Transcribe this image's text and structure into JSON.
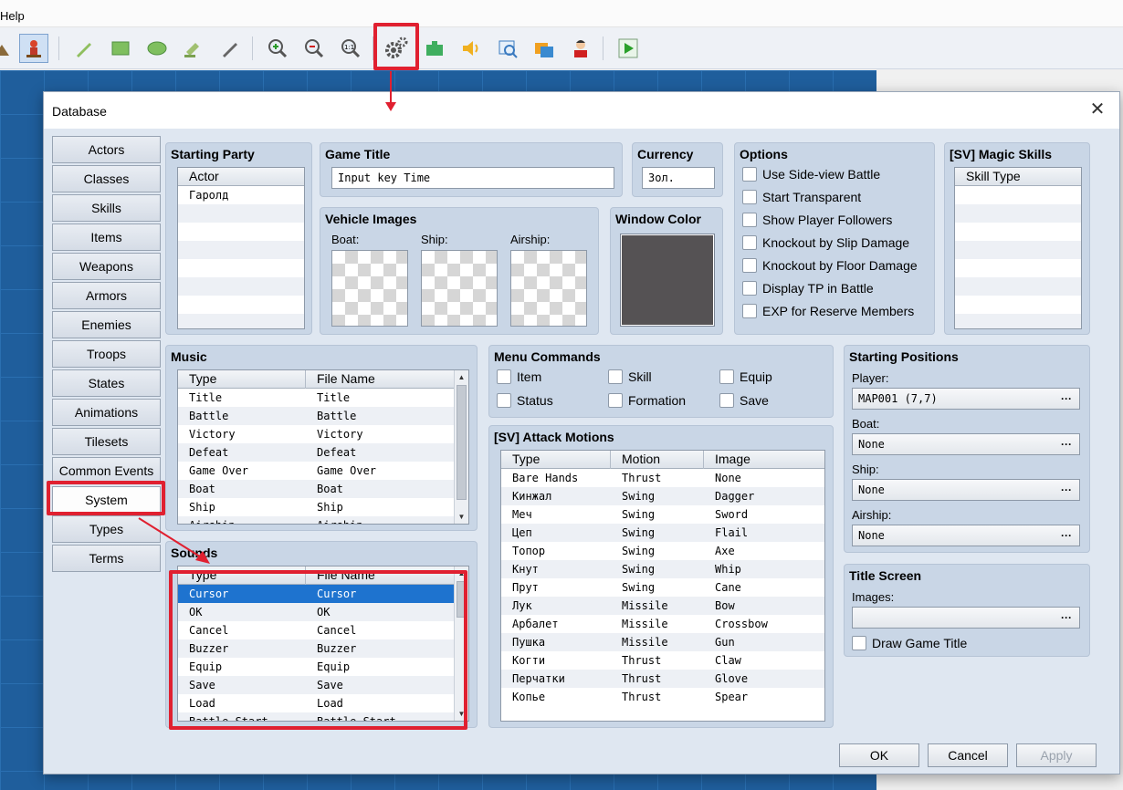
{
  "menubar": {
    "help_label": "Help"
  },
  "toolbar": {
    "icons": [
      "map-icon",
      "event-icon",
      "pencil-icon",
      "rectangle-icon",
      "ellipse-icon",
      "fill-icon",
      "shadow-pen-icon",
      "zoom-in-icon",
      "zoom-out-icon",
      "actual-size-icon",
      "gear-icon",
      "plugin-icon",
      "sound-icon",
      "resource-icon",
      "character-generator-icon",
      "playtest-icon"
    ]
  },
  "dialog": {
    "title": "Database",
    "close_icon": "close-icon",
    "tabs": [
      "Actors",
      "Classes",
      "Skills",
      "Items",
      "Weapons",
      "Armors",
      "Enemies",
      "Troops",
      "States",
      "Animations",
      "Tilesets",
      "Common Events",
      "System",
      "Types",
      "Terms"
    ],
    "active_tab": "System",
    "buttons": {
      "ok": "OK",
      "cancel": "Cancel",
      "apply": "Apply"
    }
  },
  "starting_party": {
    "title": "Starting Party",
    "col_actor": "Actor",
    "rows": [
      "Гаролд"
    ]
  },
  "game_title": {
    "title": "Game Title",
    "value": "Input key Time"
  },
  "currency": {
    "title": "Currency",
    "value": "Зол."
  },
  "vehicle_images": {
    "title": "Vehicle Images",
    "boat": "Boat:",
    "ship": "Ship:",
    "airship": "Airship:"
  },
  "window_color": {
    "title": "Window Color",
    "color": "#555254"
  },
  "options": {
    "title": "Options",
    "items": [
      "Use Side-view Battle",
      "Start Transparent",
      "Show Player Followers",
      "Knockout by Slip Damage",
      "Knockout by Floor Damage",
      "Display TP in Battle",
      "EXP for Reserve Members"
    ]
  },
  "magic_skills": {
    "title": "[SV] Magic Skills",
    "col": "Skill Type"
  },
  "music": {
    "title": "Music",
    "col_type": "Type",
    "col_file": "File Name",
    "rows": [
      "Title",
      "Battle",
      "Victory",
      "Defeat",
      "Game Over",
      "Boat",
      "Ship",
      "Airship"
    ]
  },
  "menu_commands": {
    "title": "Menu Commands",
    "items": [
      "Item",
      "Skill",
      "Equip",
      "Status",
      "Formation",
      "Save"
    ]
  },
  "attack_motions": {
    "title": "[SV] Attack Motions",
    "col_type": "Type",
    "col_motion": "Motion",
    "col_image": "Image",
    "rows": [
      [
        "Bare Hands",
        "Thrust",
        "None"
      ],
      [
        "Кинжал",
        "Swing",
        "Dagger"
      ],
      [
        "Меч",
        "Swing",
        "Sword"
      ],
      [
        "Цеп",
        "Swing",
        "Flail"
      ],
      [
        "Топор",
        "Swing",
        "Axe"
      ],
      [
        "Кнут",
        "Swing",
        "Whip"
      ],
      [
        "Прут",
        "Swing",
        "Cane"
      ],
      [
        "Лук",
        "Missile",
        "Bow"
      ],
      [
        "Арбалет",
        "Missile",
        "Crossbow"
      ],
      [
        "Пушка",
        "Missile",
        "Gun"
      ],
      [
        "Когти",
        "Thrust",
        "Claw"
      ],
      [
        "Перчатки",
        "Thrust",
        "Glove"
      ],
      [
        "Копье",
        "Thrust",
        "Spear"
      ]
    ]
  },
  "starting_positions": {
    "title": "Starting Positions",
    "player_label": "Player:",
    "player_value": "MAP001 (7,7)",
    "boat_label": "Boat:",
    "boat_value": "None",
    "ship_label": "Ship:",
    "ship_value": "None",
    "airship_label": "Airship:",
    "airship_value": "None",
    "dots": "···"
  },
  "title_screen": {
    "title": "Title Screen",
    "images_label": "Images:",
    "images_value": "",
    "draw_title": "Draw Game Title"
  },
  "sounds": {
    "title": "Sounds",
    "col_type": "Type",
    "col_file": "File Name",
    "selected": "Cursor",
    "rows": [
      "Cursor",
      "OK",
      "Cancel",
      "Buzzer",
      "Equip",
      "Save",
      "Load",
      "Battle Start"
    ]
  },
  "annotation_color": "#e02030"
}
